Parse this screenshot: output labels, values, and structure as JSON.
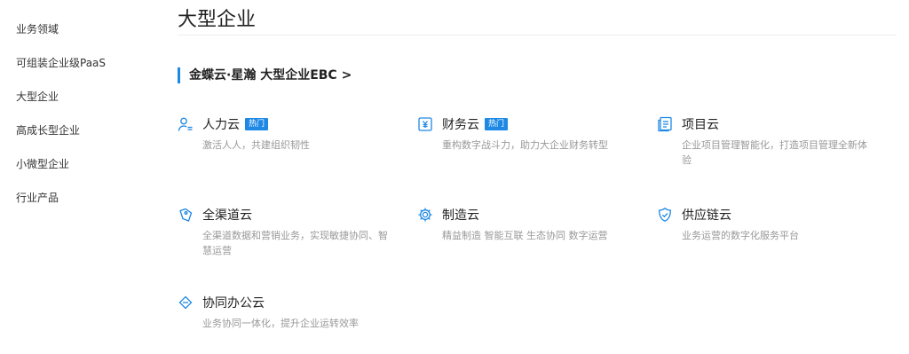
{
  "sidebar": {
    "items": [
      {
        "label": "业务领域"
      },
      {
        "label": "可组装企业级PaaS"
      },
      {
        "label": "大型企业"
      },
      {
        "label": "高成长型企业"
      },
      {
        "label": "小微型企业"
      },
      {
        "label": "行业产品"
      }
    ]
  },
  "main": {
    "title": "大型企业",
    "subheading": "金蝶云·星瀚 大型企业EBC >",
    "cards": [
      {
        "title": "人力云",
        "badge": "热门",
        "desc": "激活人人，共建组织韧性",
        "icon": "person-icon"
      },
      {
        "title": "财务云",
        "badge": "热门",
        "desc": "重构数字战斗力，助力大企业财务转型",
        "icon": "finance-icon"
      },
      {
        "title": "项目云",
        "desc": "企业项目管理智能化，打造项目管理全新体验",
        "icon": "document-icon"
      },
      {
        "title": "全渠道云",
        "desc": "全渠道数据和营销业务，实现敏捷协同、智慧运营",
        "icon": "tag-icon"
      },
      {
        "title": "制造云",
        "desc": "精益制造 智能互联 生态协同 数字运营",
        "icon": "gear-icon"
      },
      {
        "title": "供应链云",
        "desc": "业务运营的数字化服务平台",
        "icon": "shield-icon"
      },
      {
        "title": "协同办公云",
        "desc": "业务协同一体化，提升企业运转效率",
        "icon": "diamond-icon"
      }
    ]
  },
  "colors": {
    "accent": "#1e88e5",
    "text": "#222222",
    "muted": "#999999"
  }
}
